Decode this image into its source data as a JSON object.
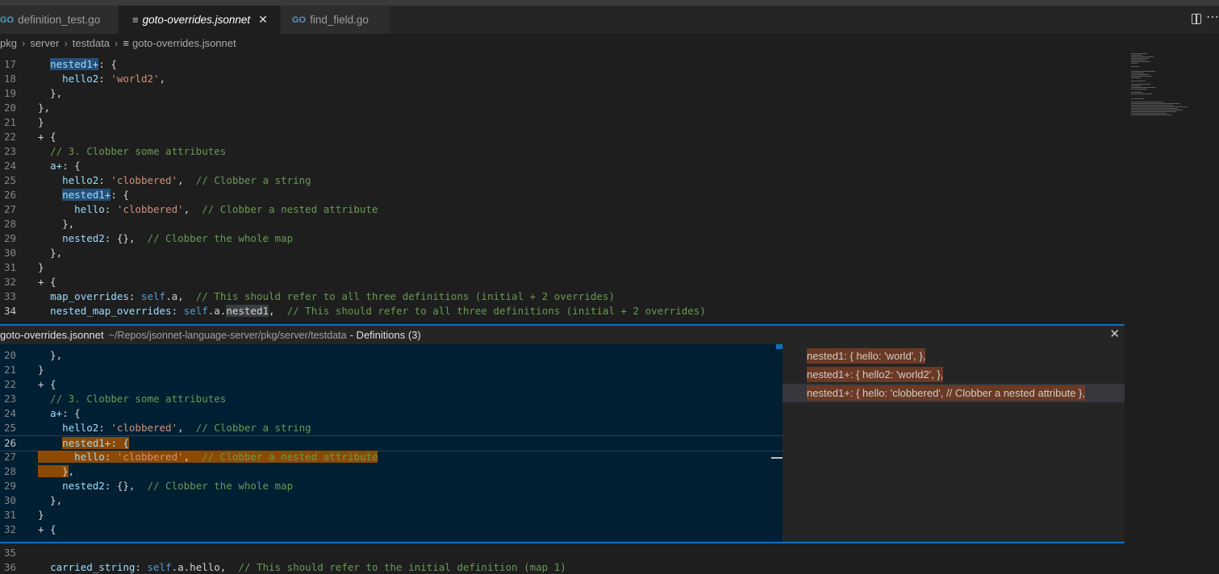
{
  "tabs": [
    {
      "label": "definition_test.go",
      "icon": "go-icon"
    },
    {
      "label": "goto-overrides.jsonnet",
      "icon": "lines-icon",
      "active": true
    },
    {
      "label": "find_field.go",
      "icon": "go-icon"
    }
  ],
  "breadcrumb": [
    "pkg",
    "server",
    "testdata",
    "goto-overrides.jsonnet"
  ],
  "editor_top": [
    {
      "n": "17",
      "code": "  <span class=\"k hl-word\">nested1+</span>: {"
    },
    {
      "n": "18",
      "code": "    <span class=\"k\">hello2</span>: <span class=\"s\">'world2'</span>,"
    },
    {
      "n": "19",
      "code": "  },"
    },
    {
      "n": "20",
      "code": "},"
    },
    {
      "n": "21",
      "code": "}"
    },
    {
      "n": "22",
      "code": "+ {"
    },
    {
      "n": "23",
      "code": "  <span class=\"c\">// 3. Clobber some attributes</span>"
    },
    {
      "n": "24",
      "code": "  <span class=\"k\">a+</span>: {"
    },
    {
      "n": "25",
      "code": "    <span class=\"k\">hello2</span>: <span class=\"s\">'clobbered'</span>,  <span class=\"c\">// Clobber a string</span>"
    },
    {
      "n": "26",
      "code": "    <span class=\"k hl-word\">nested1+</span>: {"
    },
    {
      "n": "27",
      "code": "      <span class=\"k\">hello</span>: <span class=\"s\">'clobbered'</span>,  <span class=\"c\">// Clobber a nested attribute</span>"
    },
    {
      "n": "28",
      "code": "    },"
    },
    {
      "n": "29",
      "code": "    <span class=\"k\">nested2</span>: {},  <span class=\"c\">// Clobber the whole map</span>"
    },
    {
      "n": "30",
      "code": "  },"
    },
    {
      "n": "31",
      "code": "}"
    },
    {
      "n": "32",
      "code": "+ {"
    },
    {
      "n": "33",
      "code": "  <span class=\"k\">map_overrides</span>: <span class=\"kw\">self</span>.a,  <span class=\"c\">// This should refer to all three definitions (initial + 2 overrides)</span>"
    },
    {
      "n": "34",
      "code": "  <span class=\"k\">nested_map_overrides</span>: <span class=\"kw\">self</span>.a.<span style=\"background:#3a3d41\">nested1</span>,  <span class=\"c\">// This should refer to all three definitions (initial + 2 overrides)</span>"
    }
  ],
  "peek": {
    "file": "goto-overrides.jsonnet",
    "dir": "~/Repos/jsonnet-language-server/pkg/server/testdata",
    "title": "- Definitions (3)",
    "lines": [
      {
        "n": "20",
        "code": "  },"
      },
      {
        "n": "21",
        "code": "}"
      },
      {
        "n": "22",
        "code": "+ {"
      },
      {
        "n": "23",
        "code": "  <span class=\"c\">// 3. Clobber some attributes</span>"
      },
      {
        "n": "24",
        "code": "  <span class=\"k\">a+</span>: {"
      },
      {
        "n": "25",
        "code": "    <span class=\"k\">hello2</span>: <span class=\"s\">'clobbered'</span>,  <span class=\"c\">// Clobber a string</span>"
      },
      {
        "n": "26",
        "code": "    <span class=\"peek-range k\">nested1+: {</span>"
      },
      {
        "n": "27",
        "code": "<span class=\"peek-range\">      <span class=\"k\">hello</span>: <span class=\"s\">'clobbered'</span>,  <span class=\"c\">// Clobber a nested attribute</span></span>"
      },
      {
        "n": "28",
        "code": "<span class=\"peek-range\">    }</span>,"
      },
      {
        "n": "29",
        "code": "    <span class=\"k\">nested2</span>: {},  <span class=\"c\">// Clobber the whole map</span>"
      },
      {
        "n": "30",
        "code": "  },"
      },
      {
        "n": "31",
        "code": "}"
      },
      {
        "n": "32",
        "code": "+ {"
      }
    ],
    "references": [
      "nested1: { hello: 'world', },",
      "nested1+: { hello2: 'world2', },",
      "nested1+: { hello: 'clobbered', // Clobber a nested attribute },"
    ]
  },
  "editor_bottom": [
    {
      "n": "35",
      "code": ""
    },
    {
      "n": "36",
      "code": "  <span class=\"k\">carried_string</span>: <span class=\"kw\">self</span>.a.hello,  <span class=\"c\">// This should refer to the initial definition (map 1)</span>"
    }
  ]
}
